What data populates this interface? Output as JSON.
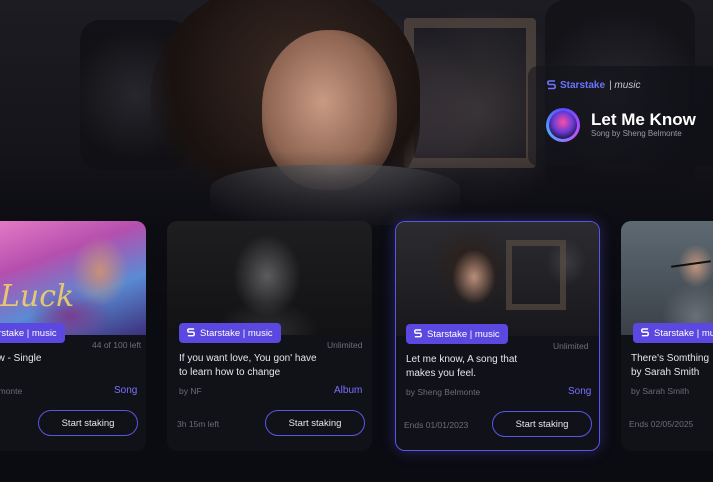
{
  "hero": {
    "brand": {
      "name": "Starstake",
      "section": "| music"
    },
    "song_title": "Let Me Know",
    "song_subtitle": "Song by Sheng Belmonte"
  },
  "colors": {
    "accent": "#5b55e6",
    "pill": "#5a48e0",
    "kind": "#7b71ff",
    "background": "#0b0b12"
  },
  "cards": [
    {
      "pill": "Starstake | music",
      "availability": "44 of 100 left",
      "title": "ow - Single",
      "artist": "elmonte",
      "kind": "Song",
      "meta": "",
      "button": "Start staking"
    },
    {
      "pill": "Starstake | music",
      "availability": "Unlimited",
      "title": "If you want love, You gon' have to learn how to change",
      "artist": "by NF",
      "kind": "Album",
      "meta": "3h 15m left",
      "button": "Start staking"
    },
    {
      "pill": "Starstake | music",
      "availability": "Unlimited",
      "title": "Let me know, A  song that makes you feel.",
      "artist": "by Sheng   Belmonte",
      "kind": "Song",
      "meta": "Ends 01/01/2023",
      "button": "Start staking"
    },
    {
      "pill": "Starstake | music",
      "availability": "",
      "title": "There's Somthing by Sarah Smith",
      "artist": "by Sarah Smith",
      "kind": "",
      "meta": "Ends 02/05/2025",
      "button": ""
    }
  ]
}
